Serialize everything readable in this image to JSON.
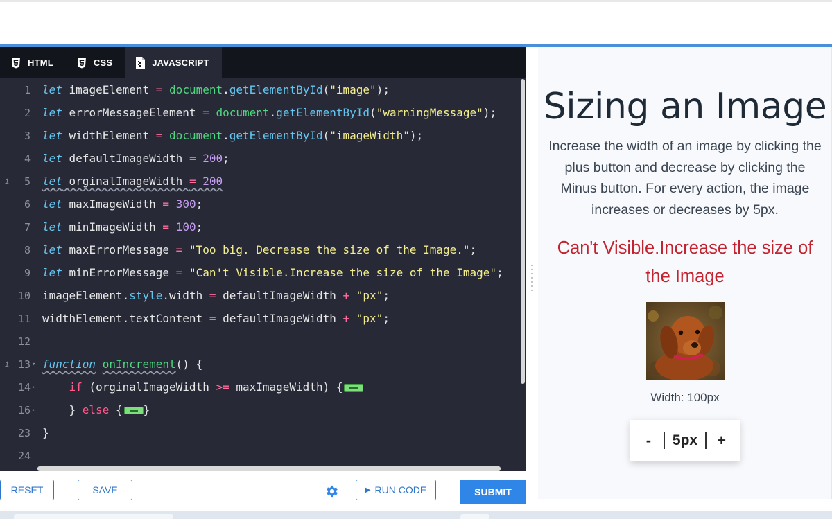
{
  "editor": {
    "tabs": [
      {
        "label": "HTML",
        "icon": "html5-icon"
      },
      {
        "label": "CSS",
        "icon": "css3-icon"
      },
      {
        "label": "JAVASCRIPT",
        "icon": "js-file-icon",
        "active": true
      }
    ],
    "lines": [
      {
        "num": "1",
        "text": "let imageElement = document.getElementById(\"image\");"
      },
      {
        "num": "2",
        "text": "let errorMessageElement = document.getElementById(\"warningMessage\");"
      },
      {
        "num": "3",
        "text": "let widthElement = document.getElementById(\"imageWidth\");"
      },
      {
        "num": "4",
        "text": "let defaultImageWidth = 200;"
      },
      {
        "num": "5",
        "text": "let orginalImageWidth = 200",
        "info": true
      },
      {
        "num": "6",
        "text": "let maxImageWidth = 300;"
      },
      {
        "num": "7",
        "text": "let minImageWidth = 100;"
      },
      {
        "num": "8",
        "text": "let maxErrorMessage = \"Too big. Decrease the size of the Image.\";"
      },
      {
        "num": "9",
        "text": "let minErrorMessage = \"Can't Visible.Increase the size of the Image\";"
      },
      {
        "num": "10",
        "text": "imageElement.style.width = defaultImageWidth + \"px\";"
      },
      {
        "num": "11",
        "text": "widthElement.textContent = defaultImageWidth + \"px\";"
      },
      {
        "num": "12",
        "text": ""
      },
      {
        "num": "13",
        "text": "function onIncrement() {",
        "info": true,
        "fold": true
      },
      {
        "num": "14",
        "text": "if (orginalImageWidth >= maxImageWidth) {",
        "fold": true
      },
      {
        "num": "16",
        "text": "} else {}",
        "fold": true
      },
      {
        "num": "23",
        "text": "}"
      },
      {
        "num": "24",
        "text": ""
      }
    ]
  },
  "toolbar": {
    "reset_label": "RESET",
    "save_label": "SAVE",
    "run_label": "RUN CODE",
    "submit_label": "SUBMIT"
  },
  "preview": {
    "title": "Sizing an Image",
    "description": "Increase the width of an image by clicking the plus button and decrease by clicking the Minus button. For every action, the image increases or decreases by 5px.",
    "warning": "Can't Visible.Increase the size of the Image",
    "width_label": "Width: 100px",
    "stepper": {
      "minus": "-",
      "value": "5px",
      "plus": "+"
    }
  },
  "colors": {
    "accent": "#2f86e6",
    "editor_bg": "#272a36",
    "warning": "#c4222f"
  }
}
